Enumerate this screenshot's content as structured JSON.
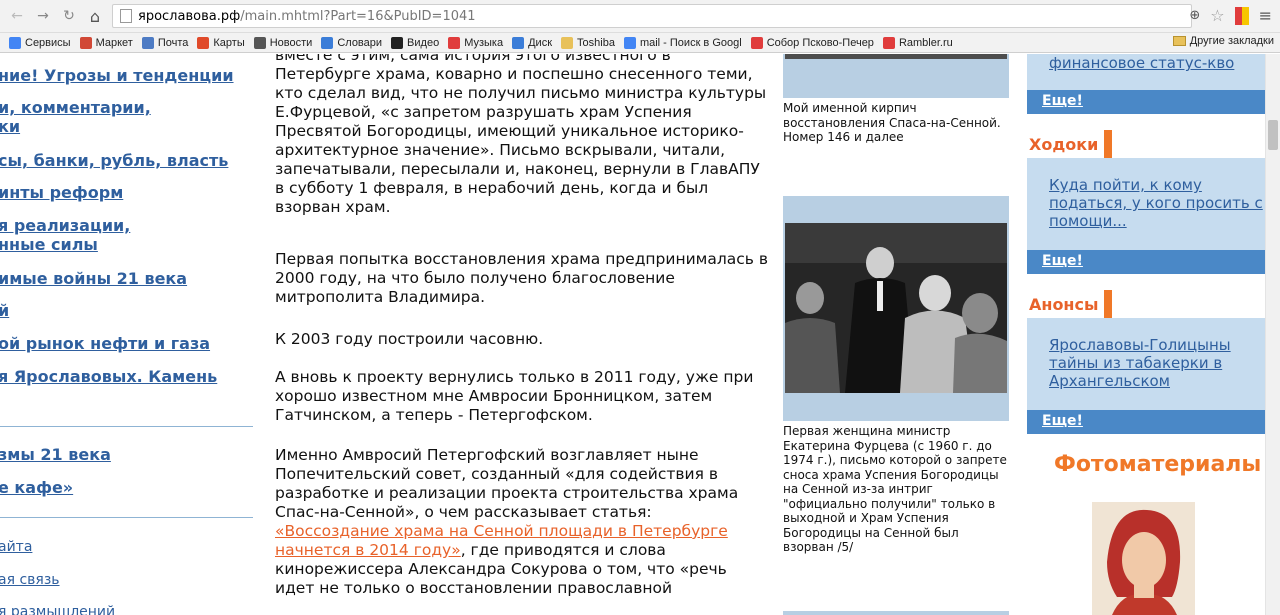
{
  "browser": {
    "url_host": "ярославова.рф",
    "url_path": "/main.mhtml?Part=16&PubID=1041",
    "bookmarks": [
      {
        "label": "Сервисы",
        "color": "#4285f4"
      },
      {
        "label": "Маркет",
        "color": "#d14836"
      },
      {
        "label": "Почта",
        "color": "#4d7bc4"
      },
      {
        "label": "Карты",
        "color": "#e04a2a"
      },
      {
        "label": "Новости",
        "color": "#555555"
      },
      {
        "label": "Словари",
        "color": "#3b7dd8"
      },
      {
        "label": "Видео",
        "color": "#222222"
      },
      {
        "label": "Музыка",
        "color": "#e03c3c"
      },
      {
        "label": "Диск",
        "color": "#3b7dd8"
      },
      {
        "label": "Toshiba",
        "color": "#e8c15a"
      },
      {
        "label": "mail - Поиск в Googl",
        "color": "#4285f4"
      },
      {
        "label": "Собор Псково-Печер",
        "color": "#e03c3c"
      },
      {
        "label": "Rambler.ru",
        "color": "#e03c3c"
      }
    ],
    "bookmarks_more": "»",
    "other_bookmarks": "Другие закладки"
  },
  "leftnav": {
    "items": [
      "ние! Угрозы и тенденции",
      "и, комментарии,",
      "ки",
      "сы, банки, рубль, власть",
      "инты реформ",
      "я реализации,",
      "нные силы",
      "имые войны 21 века",
      "й",
      "ой рынок нефти и газа",
      "я Ярославовых. Камень",
      "змы 21 века",
      "е кафе»"
    ],
    "small_items": [
      "айта",
      "ая связь",
      "я размышлений"
    ]
  },
  "article": {
    "p1": "вместе с этим, сама история этого известного в Петербурге храма, коварно и поспешно снесенного теми, кто сделал вид, что не получил письмо министра культуры Е.Фурцевой, «с запретом разрушать храм Успения Пресвятой Богородицы, имеющий уникальное историко-архитектурное значение». Письмо вскрывали, читали, запечатывали, пересылали и, наконец, вернули в ГлавАПУ в субботу 1 февраля, в нерабочий день, когда и был взорван храм.",
    "p2": "Первая попытка восстановления храма предпринималась в 2000 году, на что было получено благословение митрополита Владимира.",
    "p3": "К 2003 году построили часовню.",
    "p4": "А вновь к проекту вернулись только в 2011 году, уже при хорошо известном мне Амвросии Бронницком, затем Гатчинском, а теперь - Петергофском.",
    "p5_before": "Именно Амвросий Петергофский возглавляет ныне Попечительский совет, созданный «для содействия в разработке и реализации проекта строительства храма Спас-на-Сенной», о чем рассказывает статья: ",
    "p5_link": "«Воссоздание храма на Сенной площади в Петербурге начнется в 2014 году»",
    "p5_after": ", где приводятся и слова кинорежиссера Александра Сокурова о том, что «речь идет не только о восстановлении православной"
  },
  "images": {
    "caption1": "Мой именной кирпич восстановления Спаса-на-Сенной. Номер 146 и далее",
    "caption2": "Первая женщина министр Екатерина Фурцева (с 1960 г. до 1974 г.), письмо которой о запрете сноса храма Успения Богородицы на Сенной из-за интриг \"официально получили\" только в выходной и Храм Успения Богородицы на Сенной был взорван /5/"
  },
  "rightcol": {
    "link1": "финансовое статус-кво",
    "more_label": "Еще!",
    "heading_khodoki": "Ходоки",
    "link2": "Куда пойти, к кому податься, у кого просить с помощи...",
    "heading_anonsy": "Анонсы",
    "link3": "Ярославовы-Голицыны тайны из табакерки в Архангельском",
    "heading_foto": "Фотоматериалы"
  },
  "colors": {
    "accent": "#f07828",
    "link": "#2f5f9e",
    "box": "#c6dcef",
    "morebar": "#4a88c7"
  }
}
